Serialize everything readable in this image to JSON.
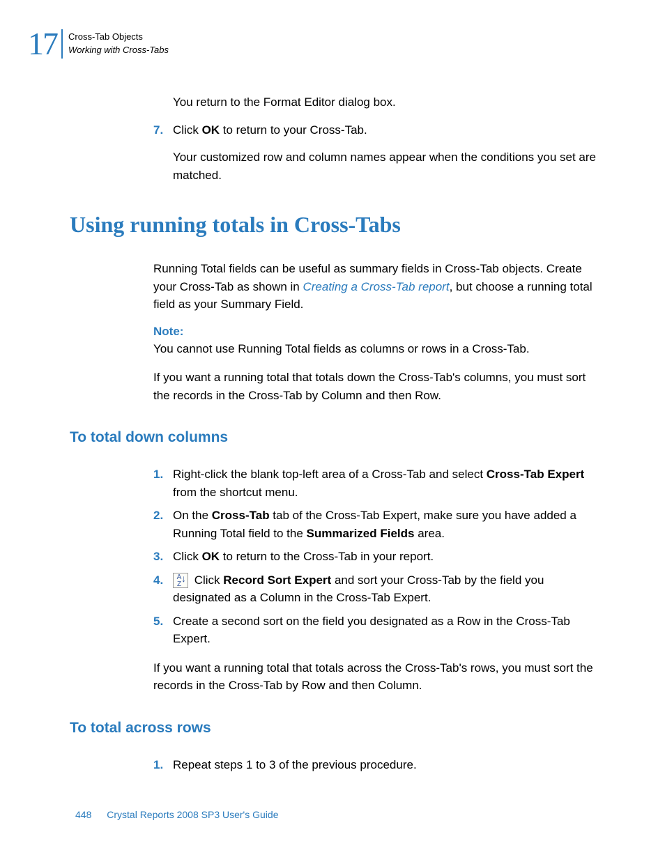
{
  "header": {
    "chapter_number": "17",
    "chapter_title": "Cross-Tab Objects",
    "section_title": "Working with Cross-Tabs"
  },
  "intro": {
    "line1": "You return to the Format Editor dialog box.",
    "step7_num": "7.",
    "step7_text_pre": "Click ",
    "step7_bold": "OK",
    "step7_text_post": " to return to your Cross-Tab.",
    "result": "Your customized row and column names appear when the conditions you set are matched."
  },
  "h2_title": "Using running totals in Cross-Tabs",
  "sec1": {
    "p1_pre": "Running Total fields can be useful as summary fields in Cross-Tab objects. Create your Cross-Tab as shown in ",
    "p1_link": "Creating a Cross-Tab report",
    "p1_post": ", but choose a running total field as your Summary Field.",
    "note_label": "Note:",
    "note_text": "You cannot use Running Total fields as columns or rows in a Cross-Tab.",
    "p2": "If you want a running total that totals down the Cross-Tab's columns, you must sort the records in the Cross-Tab by Column and then Row."
  },
  "h3_columns": "To total down columns",
  "cols": {
    "s1_num": "1.",
    "s1_pre": "Right-click the blank top-left area of a Cross-Tab and select ",
    "s1_bold": "Cross-Tab Expert",
    "s1_post": " from the shortcut menu.",
    "s2_num": "2.",
    "s2_pre": "On the ",
    "s2_bold1": "Cross-Tab",
    "s2_mid": " tab of the Cross-Tab Expert, make sure you have added a Running Total field to the ",
    "s2_bold2": "Summarized Fields",
    "s2_post": " area.",
    "s3_num": "3.",
    "s3_pre": "Click ",
    "s3_bold": "OK",
    "s3_post": " to return to the Cross-Tab in your report.",
    "s4_num": "4.",
    "s4_pre": " Click ",
    "s4_bold": "Record Sort Expert",
    "s4_post": " and sort your Cross-Tab by the field you designated as a Column in the Cross-Tab Expert.",
    "s5_num": "5.",
    "s5_text": "Create a second sort on the field you designated as a Row in the Cross-Tab Expert.",
    "p_after": "If you want a running total that totals across the Cross-Tab's rows, you must sort the records in the Cross-Tab by Row and then Column."
  },
  "h3_rows": "To total across rows",
  "rows": {
    "s1_num": "1.",
    "s1_text": "Repeat steps 1 to 3 of the previous procedure."
  },
  "footer": {
    "page": "448",
    "doc": "Crystal Reports 2008 SP3 User's Guide"
  },
  "icons": {
    "sort_icon_label": "A\nZ"
  }
}
